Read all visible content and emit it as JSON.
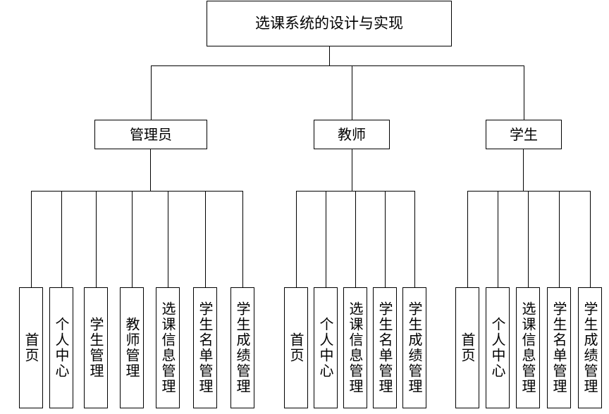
{
  "root": {
    "label": "选课系统的设计与实现"
  },
  "groups": [
    {
      "label": "管理员",
      "children": [
        "首页",
        "个人中心",
        "学生管理",
        "教师管理",
        "选课信息管理",
        "学生名单管理",
        "学生成绩管理"
      ]
    },
    {
      "label": "教师",
      "children": [
        "首页",
        "个人中心",
        "选课信息管理",
        "学生名单管理",
        "学生成绩管理"
      ]
    },
    {
      "label": "学生",
      "children": [
        "首页",
        "个人中心",
        "选课信息管理",
        "学生名单管理",
        "学生成绩管理"
      ]
    }
  ]
}
